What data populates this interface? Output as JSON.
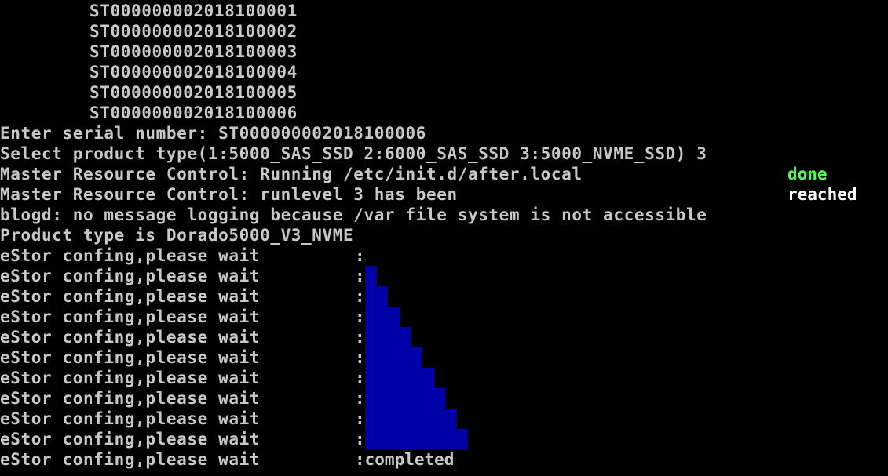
{
  "colors": {
    "background": "#000000",
    "text": "#c8c8c8",
    "done": "#54fc54",
    "reached": "#fcfcfc",
    "progress_bar": "#0000a8"
  },
  "serial_list": [
    "ST000000002018100001",
    "ST000000002018100002",
    "ST000000002018100003",
    "ST000000002018100004",
    "ST000000002018100005",
    "ST000000002018100006"
  ],
  "prompt_serial": "Enter serial number: ST000000002018100006",
  "prompt_product": "Select product type(1:5000_SAS_SSD 2:6000_SAS_SSD 3:5000_NVME_SSD) 3",
  "mrc_after_local": {
    "message": "Master Resource Control: Running /etc/init.d/after.local",
    "status": "done"
  },
  "mrc_runlevel": {
    "message": "Master Resource Control: runlevel 3 has been",
    "status": "reached"
  },
  "blogd_message": "blogd: no message logging because /var file system is not accessible",
  "product_type": "Product type is Dorado5000_V3_NVME",
  "estor_progress": {
    "label": "eStor confing,please wait",
    "colon": ":",
    "completed_text": ":completed",
    "steps": [
      0,
      1,
      2,
      3,
      4,
      5,
      6,
      7,
      8,
      9
    ]
  }
}
